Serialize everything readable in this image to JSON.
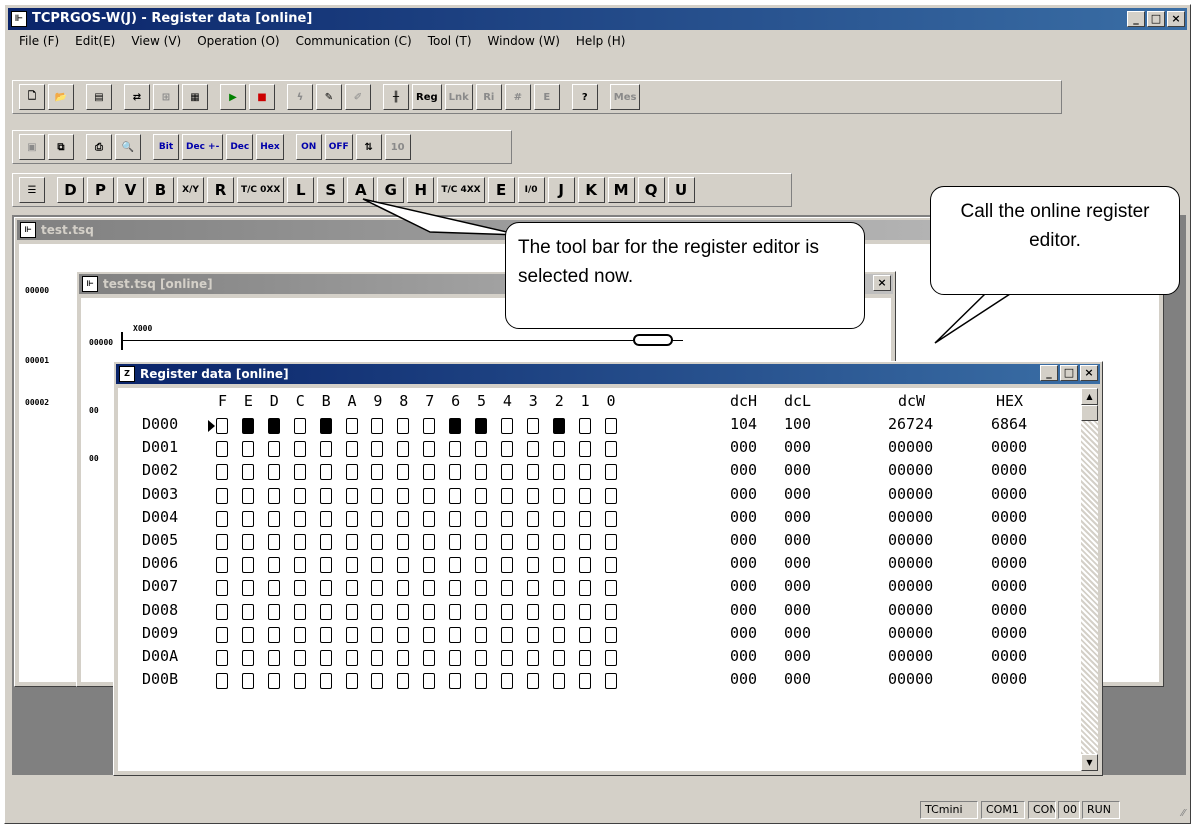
{
  "app": {
    "title": "TCPRGOS-W(J) - Register data [online]",
    "menu": [
      "File (F)",
      "Edit(E)",
      "View (V)",
      "Operation (O)",
      "Communication (C)",
      "Tool (T)",
      "Window (W)",
      "Help (H)"
    ]
  },
  "toolbar2": {
    "bit": "Bit",
    "dec_pm": "Dec +-",
    "dec": "Dec",
    "hex": "Hex",
    "on": "ON",
    "off": "OFF"
  },
  "toolbar3": {
    "items": [
      "D",
      "P",
      "V",
      "B",
      "X/Y",
      "R",
      "T/C 0XX",
      "L",
      "S",
      "A",
      "G",
      "H",
      "T/C 4XX",
      "E",
      "I/0",
      "J",
      "K",
      "M",
      "Q",
      "U"
    ]
  },
  "windows": {
    "test_tsq": "test.tsq",
    "test_tsq_online": "test.tsq [online]",
    "register": "Register data [online]",
    "line_numbers": [
      "00000",
      "00001",
      "00002"
    ],
    "contact_label": "X000",
    "inner_lines": [
      "00000",
      "00",
      "00"
    ]
  },
  "register": {
    "bit_headers": [
      "F",
      "E",
      "D",
      "C",
      "B",
      "A",
      "9",
      "8",
      "7",
      "6",
      "5",
      "4",
      "3",
      "2",
      "1",
      "0"
    ],
    "col_headers": {
      "dch": "dcH",
      "dcl": "dcL",
      "dcw": "dcW",
      "hex": "HEX"
    },
    "rows": [
      {
        "addr": "D000",
        "bits": [
          0,
          1,
          1,
          0,
          1,
          0,
          0,
          0,
          0,
          1,
          1,
          0,
          0,
          1,
          0,
          0
        ],
        "dch": "104",
        "dcl": "100",
        "dcw": "26724",
        "hex": "6864"
      },
      {
        "addr": "D001",
        "bits": [
          0,
          0,
          0,
          0,
          0,
          0,
          0,
          0,
          0,
          0,
          0,
          0,
          0,
          0,
          0,
          0
        ],
        "dch": "000",
        "dcl": "000",
        "dcw": "00000",
        "hex": "0000"
      },
      {
        "addr": "D002",
        "bits": [
          0,
          0,
          0,
          0,
          0,
          0,
          0,
          0,
          0,
          0,
          0,
          0,
          0,
          0,
          0,
          0
        ],
        "dch": "000",
        "dcl": "000",
        "dcw": "00000",
        "hex": "0000"
      },
      {
        "addr": "D003",
        "bits": [
          0,
          0,
          0,
          0,
          0,
          0,
          0,
          0,
          0,
          0,
          0,
          0,
          0,
          0,
          0,
          0
        ],
        "dch": "000",
        "dcl": "000",
        "dcw": "00000",
        "hex": "0000"
      },
      {
        "addr": "D004",
        "bits": [
          0,
          0,
          0,
          0,
          0,
          0,
          0,
          0,
          0,
          0,
          0,
          0,
          0,
          0,
          0,
          0
        ],
        "dch": "000",
        "dcl": "000",
        "dcw": "00000",
        "hex": "0000"
      },
      {
        "addr": "D005",
        "bits": [
          0,
          0,
          0,
          0,
          0,
          0,
          0,
          0,
          0,
          0,
          0,
          0,
          0,
          0,
          0,
          0
        ],
        "dch": "000",
        "dcl": "000",
        "dcw": "00000",
        "hex": "0000"
      },
      {
        "addr": "D006",
        "bits": [
          0,
          0,
          0,
          0,
          0,
          0,
          0,
          0,
          0,
          0,
          0,
          0,
          0,
          0,
          0,
          0
        ],
        "dch": "000",
        "dcl": "000",
        "dcw": "00000",
        "hex": "0000"
      },
      {
        "addr": "D007",
        "bits": [
          0,
          0,
          0,
          0,
          0,
          0,
          0,
          0,
          0,
          0,
          0,
          0,
          0,
          0,
          0,
          0
        ],
        "dch": "000",
        "dcl": "000",
        "dcw": "00000",
        "hex": "0000"
      },
      {
        "addr": "D008",
        "bits": [
          0,
          0,
          0,
          0,
          0,
          0,
          0,
          0,
          0,
          0,
          0,
          0,
          0,
          0,
          0,
          0
        ],
        "dch": "000",
        "dcl": "000",
        "dcw": "00000",
        "hex": "0000"
      },
      {
        "addr": "D009",
        "bits": [
          0,
          0,
          0,
          0,
          0,
          0,
          0,
          0,
          0,
          0,
          0,
          0,
          0,
          0,
          0,
          0
        ],
        "dch": "000",
        "dcl": "000",
        "dcw": "00000",
        "hex": "0000"
      },
      {
        "addr": "D00A",
        "bits": [
          0,
          0,
          0,
          0,
          0,
          0,
          0,
          0,
          0,
          0,
          0,
          0,
          0,
          0,
          0,
          0
        ],
        "dch": "000",
        "dcl": "000",
        "dcw": "00000",
        "hex": "0000"
      },
      {
        "addr": "D00B",
        "bits": [
          0,
          0,
          0,
          0,
          0,
          0,
          0,
          0,
          0,
          0,
          0,
          0,
          0,
          0,
          0,
          0
        ],
        "dch": "000",
        "dcl": "000",
        "dcw": "00000",
        "hex": "0000"
      }
    ]
  },
  "callouts": {
    "toolbar": "The tool bar for the register editor is selected now.",
    "online": "Call the online register editor."
  },
  "statusbar": [
    "TCmini",
    "COM1",
    "CON",
    "00",
    "RUN"
  ]
}
